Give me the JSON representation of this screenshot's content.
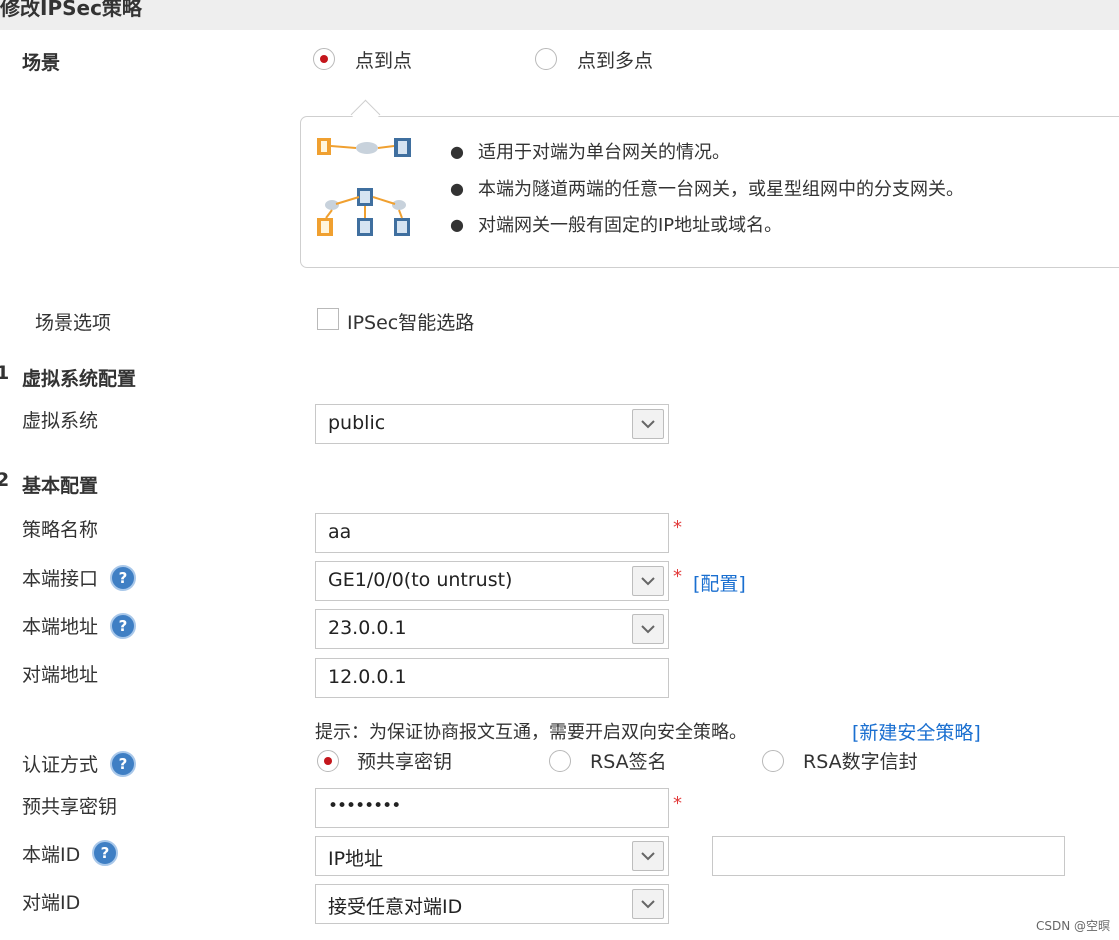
{
  "window": {
    "title": "修改IPSec策略"
  },
  "scene": {
    "label": "场景",
    "options": [
      {
        "label": "点到点",
        "selected": true
      },
      {
        "label": "点到多点",
        "selected": false
      }
    ],
    "tip_bullets": [
      "适用于对端为单台网关的情况。",
      "本端为隧道两端的任意一台网关，或星型组网中的分支网关。",
      "对端网关一般有固定的IP地址或域名。"
    ],
    "options_label": "场景选项",
    "smart_routing_label": "IPSec智能选路",
    "smart_routing_checked": false
  },
  "section1": {
    "number": "1",
    "title": "虚拟系统配置",
    "vsys_label": "虚拟系统",
    "vsys_value": "public"
  },
  "section2": {
    "number": "2",
    "title": "基本配置",
    "policy_name_label": "策略名称",
    "policy_name_value": "aa",
    "local_interface_label": "本端接口",
    "local_interface_value": "GE1/0/0(to untrust)",
    "configure_link": "[配置]",
    "local_address_label": "本端地址",
    "local_address_value": "23.0.0.1",
    "peer_address_label": "对端地址",
    "peer_address_value": "12.0.0.1",
    "hint_text": "提示：为保证协商报文互通，需要开启双向安全策略。",
    "new_policy_link": "[新建安全策略]",
    "auth_label": "认证方式",
    "auth_options": [
      {
        "label": "预共享密钥",
        "selected": true
      },
      {
        "label": "RSA签名",
        "selected": false
      },
      {
        "label": "RSA数字信封",
        "selected": false
      }
    ],
    "psk_label": "预共享密钥",
    "psk_value": "••••••••",
    "local_id_label": "本端ID",
    "local_id_value": "IP地址",
    "local_id_extra_value": "",
    "peer_id_label": "对端ID",
    "peer_id_value": "接受任意对端ID"
  },
  "required_mark": "*",
  "help_glyph": "?",
  "watermark": "CSDN @空暝",
  "colors": {
    "radio_selected": "#c4161c",
    "link": "#1a6fd0",
    "required": "#e23a3a",
    "help_icon": "#3f7fc4"
  }
}
